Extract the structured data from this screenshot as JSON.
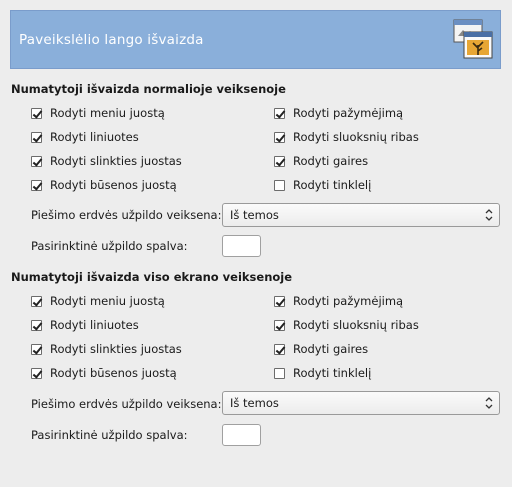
{
  "header": {
    "title": "Paveikslėlio lango išvaizda"
  },
  "sections": [
    {
      "title": "Numatytoji išvaizda normalioje veiksenoje",
      "left": [
        {
          "label": "Rodyti meniu juostą",
          "checked": true
        },
        {
          "label": "Rodyti liniuotes",
          "checked": true
        },
        {
          "label": "Rodyti slinkties juostas",
          "checked": true
        },
        {
          "label": "Rodyti būsenos juostą",
          "checked": true
        }
      ],
      "right": [
        {
          "label": "Rodyti pažymėjimą",
          "checked": true
        },
        {
          "label": "Rodyti sluoksnių ribas",
          "checked": true
        },
        {
          "label": "Rodyti gaires",
          "checked": true
        },
        {
          "label": "Rodyti tinklelį",
          "checked": false
        }
      ],
      "fill_mode_label": "Piešimo erdvės užpildo veiksena:",
      "fill_mode_value": "Iš temos",
      "custom_color_label": "Pasirinktinė užpildo spalva:",
      "custom_color": "#ffffff"
    },
    {
      "title": "Numatytoji išvaizda viso ekrano veiksenoje",
      "left": [
        {
          "label": "Rodyti meniu juostą",
          "checked": true
        },
        {
          "label": "Rodyti liniuotes",
          "checked": true
        },
        {
          "label": "Rodyti slinkties juostas",
          "checked": true
        },
        {
          "label": "Rodyti būsenos juostą",
          "checked": true
        }
      ],
      "right": [
        {
          "label": "Rodyti pažymėjimą",
          "checked": true
        },
        {
          "label": "Rodyti sluoksnių ribas",
          "checked": true
        },
        {
          "label": "Rodyti gaires",
          "checked": true
        },
        {
          "label": "Rodyti tinklelį",
          "checked": false
        }
      ],
      "fill_mode_label": "Piešimo erdvės užpildo veiksena:",
      "fill_mode_value": "Iš temos",
      "custom_color_label": "Pasirinktinė užpildo spalva:",
      "custom_color": "#ffffff"
    }
  ],
  "colors": {
    "header_bg": "#8aafda",
    "window_bg": "#ededed"
  },
  "icons": {
    "header": "image-window-icon",
    "combo": "updown-arrows-icon"
  }
}
